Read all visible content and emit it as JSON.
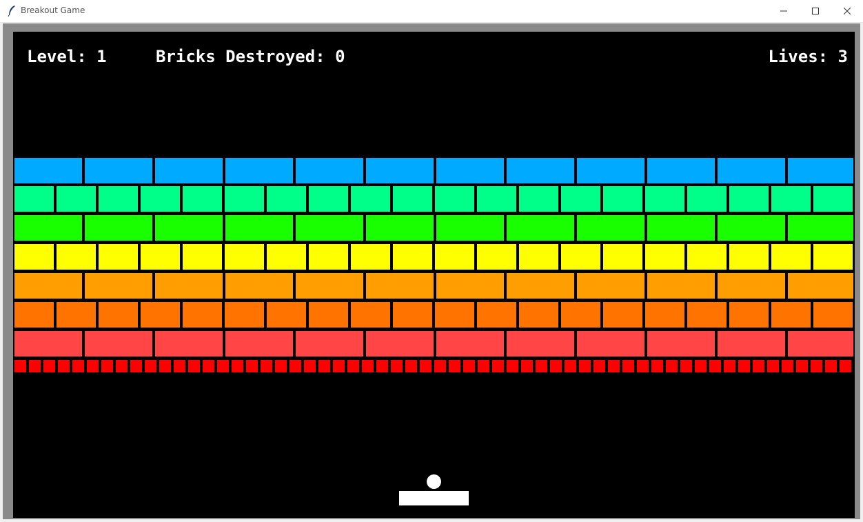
{
  "window": {
    "title": "Breakout Game",
    "icon": "feather-icon",
    "controls": [
      "minimize-icon",
      "maximize-icon",
      "close-icon"
    ]
  },
  "hud": {
    "level_text": "Level: 1",
    "bricks_text": "Bricks Destroyed: 0",
    "lives_text": "Lives: 3",
    "level": 1,
    "bricks_destroyed": 0,
    "lives": 3
  },
  "game": {
    "background": "#000000",
    "ball_color": "#ffffff",
    "paddle_color": "#ffffff",
    "brick_rows": [
      {
        "color": "#00aaff",
        "count": 12
      },
      {
        "color": "#00ff88",
        "count": 20
      },
      {
        "color": "#1aff00",
        "count": 12
      },
      {
        "color": "#ffff00",
        "count": 20
      },
      {
        "color": "#ff9e00",
        "count": 12
      },
      {
        "color": "#ff7300",
        "count": 20
      },
      {
        "color": "#ff4545",
        "count": 12
      },
      {
        "color": "#ff0000",
        "count": 58
      }
    ]
  }
}
